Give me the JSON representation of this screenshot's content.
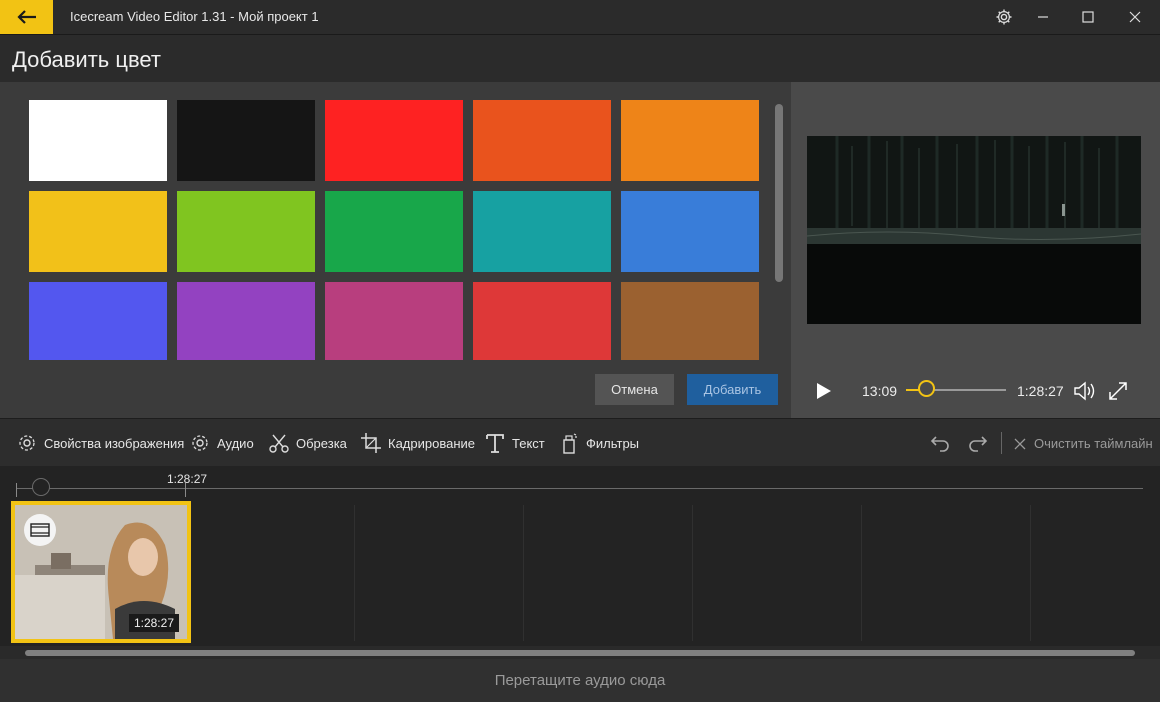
{
  "window": {
    "title": "Icecream Video Editor 1.31 - Мой проект 1",
    "accent_color": "#f2c314"
  },
  "header": {
    "title": "Добавить цвет"
  },
  "color_grid": {
    "swatches": [
      {
        "color": "#ffffff"
      },
      {
        "color": "#151515"
      },
      {
        "color": "#fe2222"
      },
      {
        "color": "#e9531d"
      },
      {
        "color": "#ee8418"
      },
      {
        "color": "#f2c119"
      },
      {
        "color": "#80c520"
      },
      {
        "color": "#18a74a"
      },
      {
        "color": "#17a1a2"
      },
      {
        "color": "#397dd9"
      },
      {
        "color": "#5357ef"
      },
      {
        "color": "#9342c1"
      },
      {
        "color": "#b83e7e"
      },
      {
        "color": "#de3838"
      },
      {
        "color": "#9b6130"
      }
    ]
  },
  "dialog": {
    "cancel_label": "Отмена",
    "add_label": "Добавить"
  },
  "player": {
    "current_time": "13:09",
    "total_time": "1:28:27",
    "progress": 0.15
  },
  "toolbar": {
    "image_props": "Свойства изображения",
    "audio": "Аудио",
    "trim": "Обрезка",
    "crop": "Кадрирование",
    "text": "Текст",
    "filters": "Фильтры",
    "clear_timeline": "Очистить таймлайн"
  },
  "timeline": {
    "ruler_label": "1:28:27",
    "clip_duration": "1:28:27"
  },
  "audio_drop": {
    "label": "Перетащите аудио сюда"
  }
}
